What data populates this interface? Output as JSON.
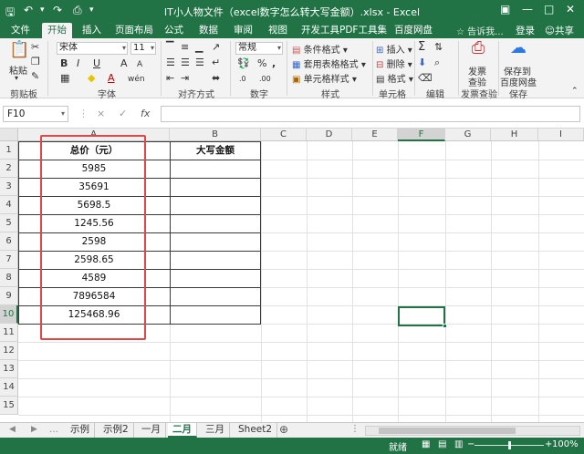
{
  "window": {
    "title": "IT小人物文件（excel数字怎么转大写金额）.xlsx - Excel",
    "save_icon": "save-icon",
    "undo_icon": "undo-icon",
    "redo_icon": "redo-icon"
  },
  "tabs": [
    "文件",
    "开始",
    "插入",
    "页面布局",
    "公式",
    "数据",
    "审阅",
    "视图",
    "开发工具",
    "PDF工具集",
    "百度网盘"
  ],
  "active_tab": "开始",
  "tell_me": "告诉我...",
  "login": "登录",
  "share": "共享",
  "ribbon": {
    "clipboard": {
      "label": "剪贴板",
      "paste": "粘贴"
    },
    "font": {
      "label": "字体",
      "name": "宋体",
      "size": "11",
      "bold": "B",
      "italic": "I",
      "underline": "U",
      "grow": "A",
      "shrink": "A",
      "font_color": "A",
      "phonetic": "wén"
    },
    "alignment": {
      "label": "对齐方式"
    },
    "number": {
      "label": "数字",
      "format": "常规",
      "percent": "%",
      "comma": ",",
      "inc": ".0",
      "dec": ".00"
    },
    "styles": {
      "label": "样式",
      "cond": "条件格式",
      "table": "套用表格格式",
      "cell": "单元格样式"
    },
    "cells": {
      "label": "单元格",
      "insert": "插入",
      "delete": "删除",
      "format": "格式"
    },
    "editing": {
      "label": "编辑"
    },
    "invoice": {
      "label": "发票查验",
      "btn1": "发票",
      "btn2": "查验"
    },
    "save": {
      "label": "保存",
      "btn1": "保存到",
      "btn2": "百度网盘"
    }
  },
  "formula_bar": {
    "name_box": "F10",
    "cancel": "×",
    "enter": "✓",
    "fx": "fx",
    "value": ""
  },
  "columns": [
    "A",
    "B",
    "C",
    "D",
    "E",
    "F",
    "G",
    "H",
    "I"
  ],
  "rows": [
    "1",
    "2",
    "3",
    "4",
    "5",
    "6",
    "7",
    "8",
    "9",
    "10",
    "11",
    "12",
    "13",
    "14",
    "15"
  ],
  "table": {
    "header_a": "总价（元）",
    "header_b": "大写金额",
    "values": [
      "5985",
      "35691",
      "5698.5",
      "1245.56",
      "2598",
      "2598.65",
      "4589",
      "7896584",
      "125468.96"
    ]
  },
  "sheets": [
    "示例",
    "示例2",
    "一月",
    "二月",
    "三月",
    "Sheet2"
  ],
  "active_sheet": "二月",
  "status": {
    "ready": "就绪",
    "zoom": "100%"
  },
  "colors": {
    "accent": "#217346",
    "highlight_box": "#e04848"
  }
}
